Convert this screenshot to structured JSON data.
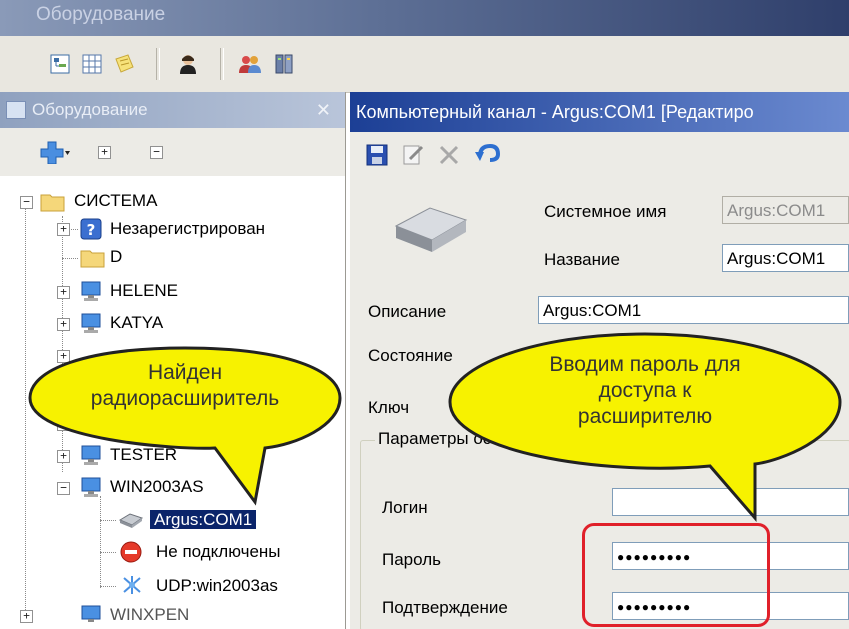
{
  "window": {
    "title": "Оборудование"
  },
  "left_panel": {
    "title": "Оборудование",
    "tree": [
      {
        "label": "СИСТЕМА",
        "icon": "folder-icon"
      },
      {
        "label": "Незарегистрирован",
        "icon": "unknown-device-icon"
      },
      {
        "label": "D",
        "icon": "folder-icon"
      },
      {
        "label": "HELENE",
        "icon": "computer-icon"
      },
      {
        "label": "KATYA",
        "icon": "computer-icon"
      },
      {
        "label": "TESTER",
        "icon": "computer-icon"
      },
      {
        "label": "WIN2003AS",
        "icon": "computer-icon"
      },
      {
        "label": "Argus:COM1",
        "icon": "com-port-icon",
        "selected": true
      },
      {
        "label": "Не подключены",
        "icon": "no-entry-icon"
      },
      {
        "label": "UDP:win2003as",
        "icon": "network-icon"
      },
      {
        "label": "WINXPEN",
        "icon": "computer-icon"
      }
    ]
  },
  "right_panel": {
    "title": "Компьютерный канал - Argus:COM1 [Редактиро",
    "form": {
      "system_name_label": "Системное имя",
      "system_name_value": "Argus:COM1",
      "name_label": "Название",
      "name_value": "Argus:COM1",
      "description_label": "Описание",
      "description_value": "Argus:COM1",
      "state_label": "Состояние",
      "key_label": "Ключ",
      "params_group": "Параметры ос",
      "login_label": "Логин",
      "login_value": "",
      "password_label": "Пароль",
      "password_value": "●●●●●●●●●",
      "confirm_label": "Подтверждение",
      "confirm_value": "●●●●●●●●●"
    }
  },
  "callouts": {
    "left_line1": "Найден",
    "left_line2": "радиорасширитель",
    "right_line1": "Вводим пароль для",
    "right_line2": "доступа к",
    "right_line3": "расширителю"
  },
  "colors": {
    "selection": "#0a246a",
    "callout_fill": "#f7f200",
    "highlight": "#e0202a"
  }
}
